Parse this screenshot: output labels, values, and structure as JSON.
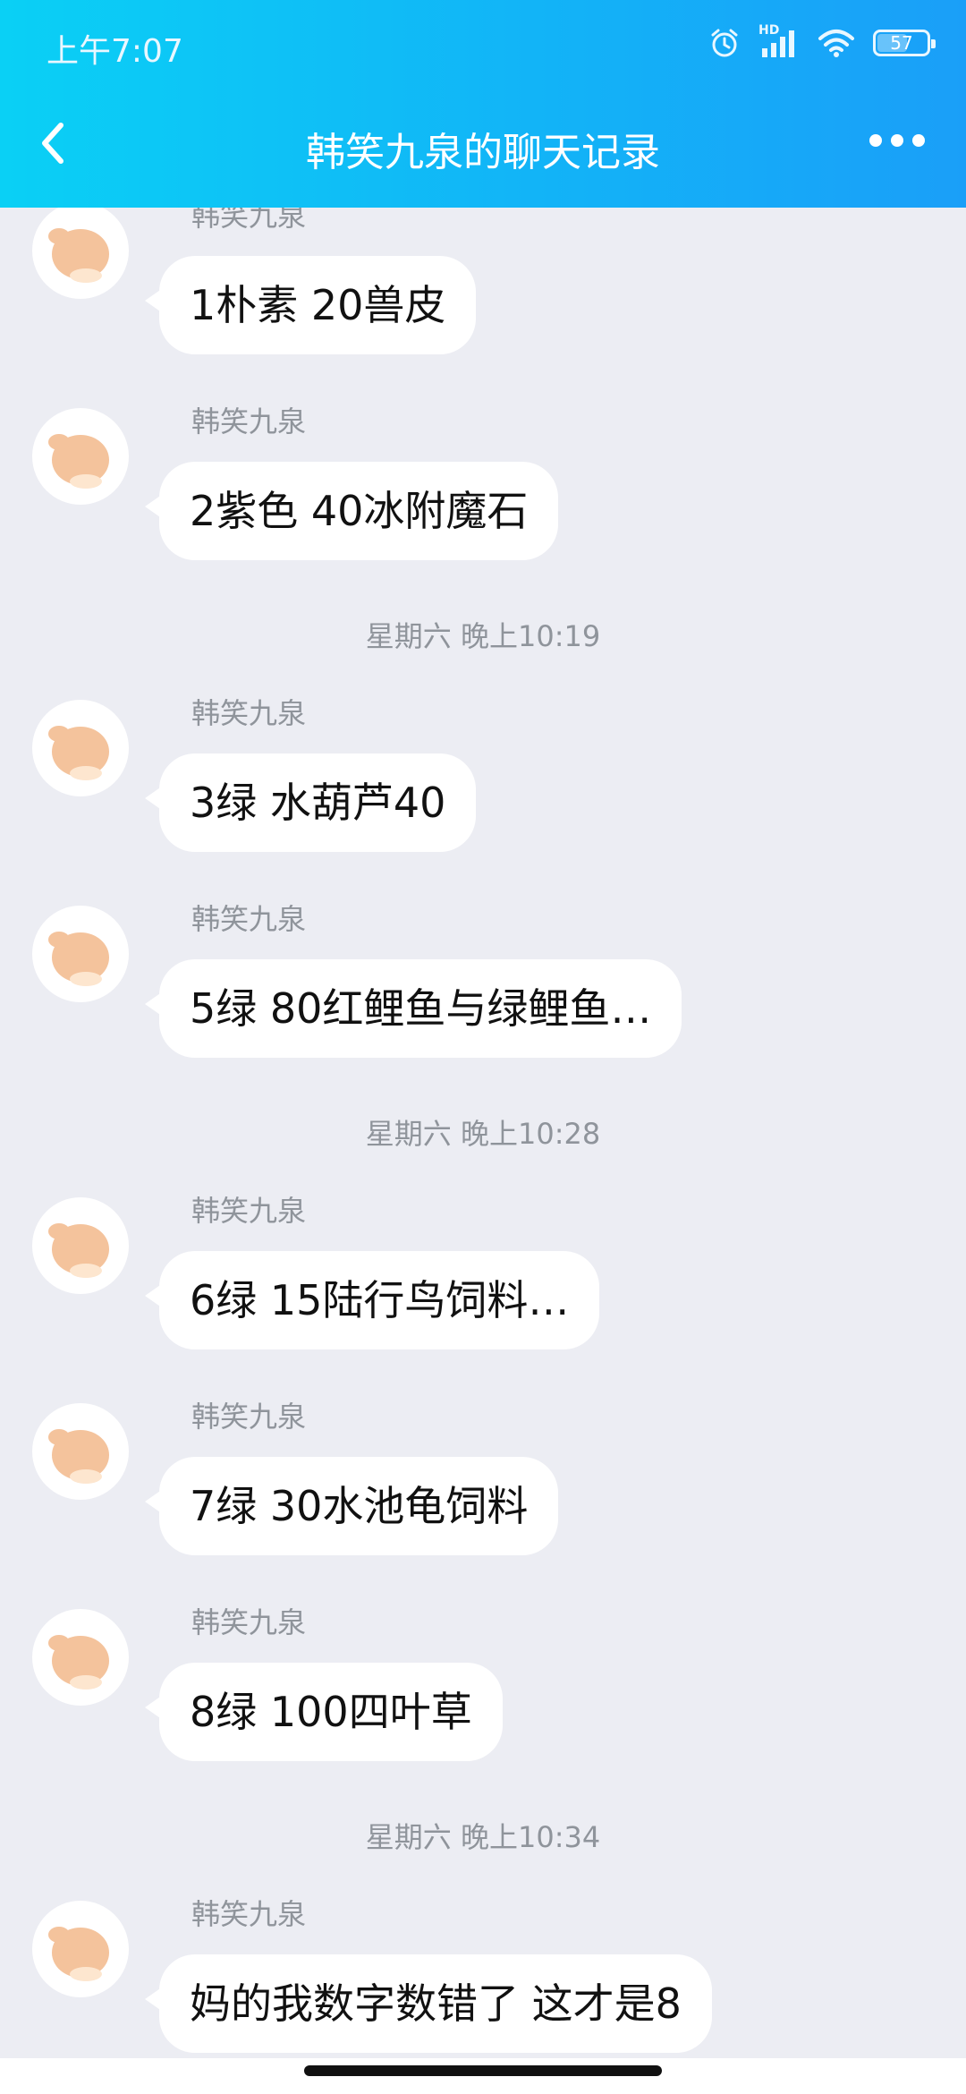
{
  "status_bar": {
    "time": "上午7:07",
    "network_label": "HD",
    "battery": "57"
  },
  "header": {
    "title": "韩笑九泉的聊天记录",
    "back_icon": "chevron-left-icon",
    "more_icon": "more-dots-icon"
  },
  "timestamps": {
    "t1": "星期六 晚上10:19",
    "t2": "星期六 晚上10:28",
    "t3": "星期六 晚上10:34"
  },
  "messages": [
    {
      "sender": "韩笑九泉",
      "text": "1朴素 20兽皮"
    },
    {
      "sender": "韩笑九泉",
      "text": "2紫色 40冰附魔石"
    },
    {
      "sender": "韩笑九泉",
      "text": "3绿 水葫芦40"
    },
    {
      "sender": "韩笑九泉",
      "text": "5绿 80红鲤鱼与绿鲤鱼…"
    },
    {
      "sender": "韩笑九泉",
      "text": "6绿 15陆行鸟饲料…"
    },
    {
      "sender": "韩笑九泉",
      "text": "7绿 30水池龟饲料"
    },
    {
      "sender": "韩笑九泉",
      "text": "8绿 100四叶草"
    },
    {
      "sender": "韩笑九泉",
      "text": "妈的我数字数错了 这才是8"
    }
  ],
  "colors": {
    "header_gradient_start": "#0ad0f5",
    "header_gradient_end": "#1a9ff8",
    "chat_background": "#ecedf3",
    "bubble": "#ffffff",
    "meta_text": "#8f949b"
  }
}
